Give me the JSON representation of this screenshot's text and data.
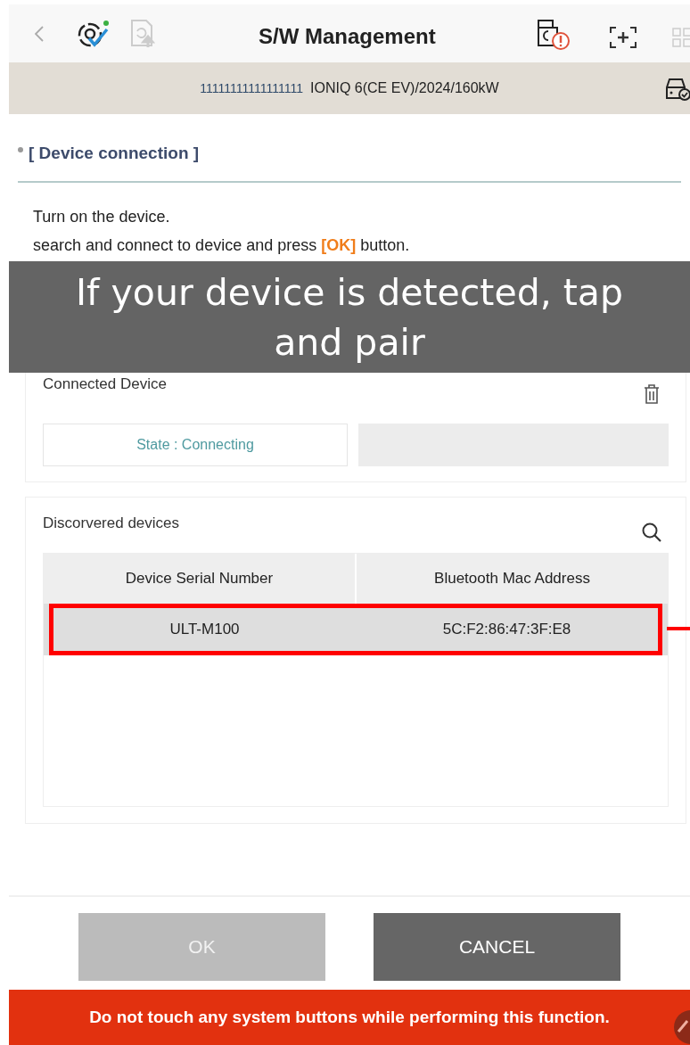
{
  "header": {
    "title": "S/W Management"
  },
  "vehicle_bar": {
    "vin": "11111111111111111",
    "model": "IONIQ 6(CE EV)/2024/160kW"
  },
  "section_title": "[ Device connection ]",
  "instructions": [
    "Turn on the device.",
    "search and connect to device and press **[OK]** button."
  ],
  "caption": "If your device is detected, tap and pair",
  "connected_device": {
    "title": "Connected Device",
    "state": "State : Connecting"
  },
  "discovered_devices": {
    "title": "Discorvered devices",
    "columns": [
      "Device Serial Number",
      "Bluetooth Mac Address"
    ],
    "rows": [
      {
        "cells": [
          "ULT-M100",
          "5C:F2:86:47:3F:E8"
        ],
        "selected": true
      }
    ]
  },
  "buttons": [
    {
      "label": "OK",
      "disabled": true
    },
    {
      "label": "CANCEL",
      "disabled": false
    }
  ],
  "warning_banner": "Do not touch any system buttons while performing this function."
}
